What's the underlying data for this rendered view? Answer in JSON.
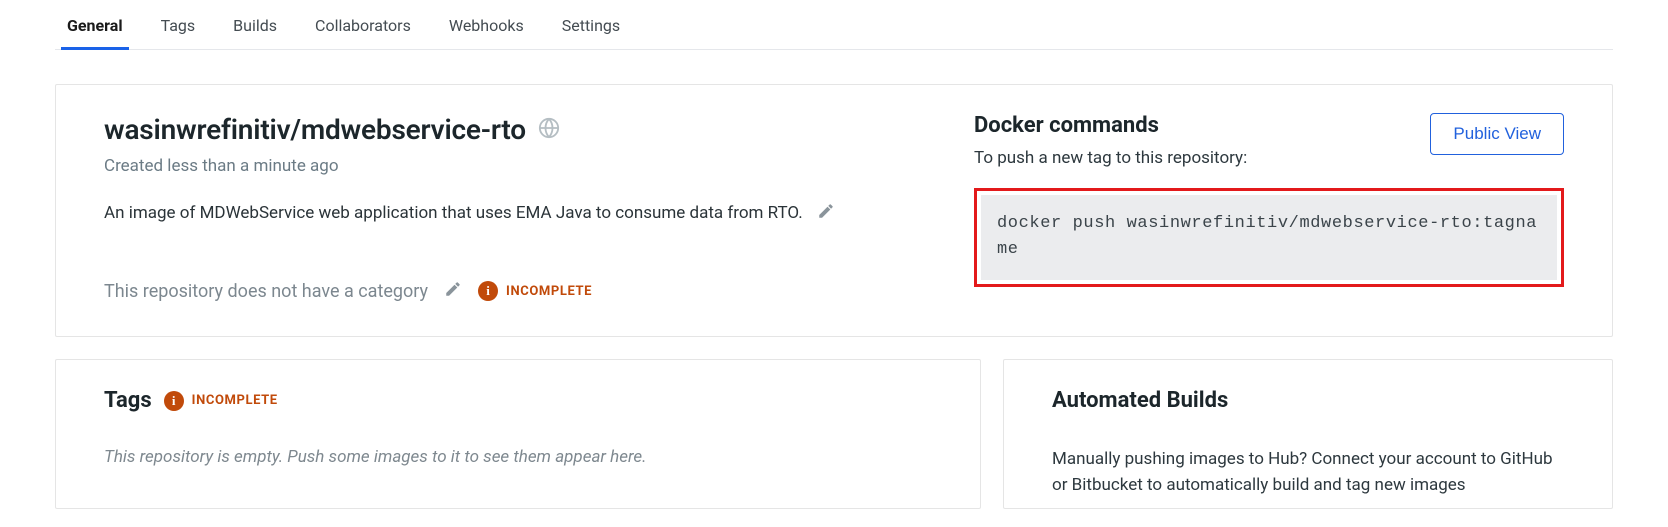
{
  "tabs": {
    "general": "General",
    "tags": "Tags",
    "builds": "Builds",
    "collaborators": "Collaborators",
    "webhooks": "Webhooks",
    "settings": "Settings"
  },
  "repo": {
    "title": "wasinwrefinitiv/mdwebservice-rto",
    "created": "Created less than a minute ago",
    "description": "An image of MDWebService web application that uses EMA Java to consume data from RTO.",
    "no_category": "This repository does not have a category",
    "incomplete": "INCOMPLETE"
  },
  "docker": {
    "title": "Docker commands",
    "public_view": "Public View",
    "hint": "To push a new tag to this repository:",
    "command": "docker push wasinwrefinitiv/mdwebservice-rto:tagname"
  },
  "tags_panel": {
    "title": "Tags",
    "incomplete": "INCOMPLETE",
    "empty": "This repository is empty. Push some images to it to see them appear here."
  },
  "autobuilds": {
    "title": "Automated Builds",
    "desc": "Manually pushing images to Hub? Connect your account to GitHub or Bitbucket to automatically build and tag new images"
  }
}
